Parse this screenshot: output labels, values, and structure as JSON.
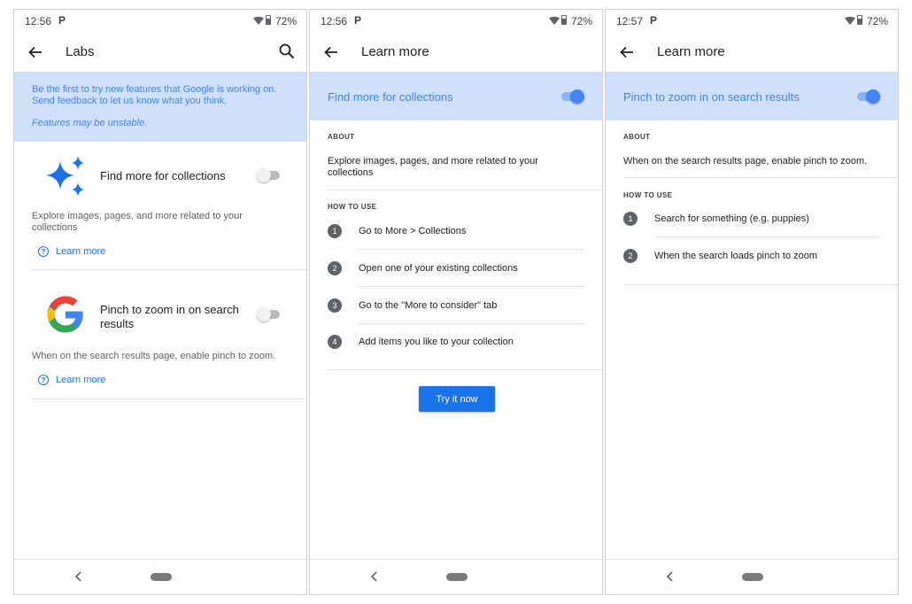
{
  "screens": [
    {
      "status": {
        "time": "12:56",
        "app_icon": "P",
        "battery": "72%"
      },
      "appbar": {
        "title": "Labs"
      },
      "banner": {
        "line1": "Be the first to try new features that Google is working on.",
        "line2": "Send feedback to let us know what you think.",
        "note": "Features may be unstable."
      },
      "experiments": [
        {
          "title": "Find more for collections",
          "description": "Explore images, pages, and more related to your collections",
          "learn_more": "Learn more",
          "enabled": false
        },
        {
          "title": "Pinch to zoom in on search results",
          "description": "When on the search results page, enable pinch to zoom.",
          "learn_more": "Learn more",
          "enabled": false
        }
      ]
    },
    {
      "status": {
        "time": "12:56",
        "app_icon": "P",
        "battery": "72%"
      },
      "appbar": {
        "title": "Learn more"
      },
      "banner": {
        "label": "Find more for collections",
        "enabled": true
      },
      "about": {
        "heading": "ABOUT",
        "text": "Explore images, pages, and more related to your collections"
      },
      "how_to": {
        "heading": "HOW TO USE",
        "steps": [
          {
            "num": "1",
            "text": "Go to More > Collections"
          },
          {
            "num": "2",
            "text": "Open one of your existing collections"
          },
          {
            "num": "3",
            "text": "Go to the \"More to consider\" tab"
          },
          {
            "num": "4",
            "text": "Add items you like to your collection"
          }
        ]
      },
      "cta": "Try it now"
    },
    {
      "status": {
        "time": "12:57",
        "app_icon": "P",
        "battery": "72%"
      },
      "appbar": {
        "title": "Learn more"
      },
      "banner": {
        "label": "Pinch to zoom in on search results",
        "enabled": true
      },
      "about": {
        "heading": "ABOUT",
        "text": "When on the search results page, enable pinch to zoom."
      },
      "how_to": {
        "heading": "HOW TO USE",
        "steps": [
          {
            "num": "1",
            "text": "Search for something (e.g. puppies)"
          },
          {
            "num": "2",
            "text": "When the search loads pinch to zoom"
          }
        ]
      }
    }
  ],
  "colors": {
    "accent": "#4285f4",
    "banner_bg": "#cfe0fa",
    "button": "#1a73e8",
    "text": "#202124"
  },
  "icons": {
    "back": "arrow-left-icon",
    "search": "search-icon",
    "sparkle": "sparkle-icon",
    "google": "google-g-logo",
    "help": "help-circle-icon",
    "nav_back": "nav-back-icon",
    "nav_home": "nav-home-pill"
  }
}
